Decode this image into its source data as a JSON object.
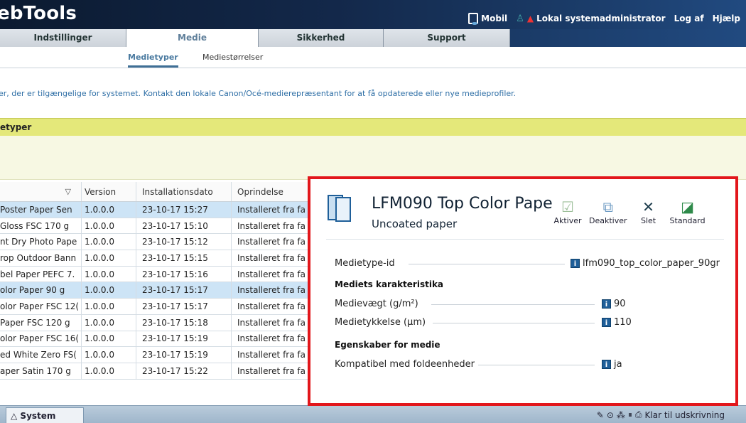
{
  "header": {
    "brand": "ebTools",
    "mobile_label": "Mobil",
    "user_label": "Lokal systemadministrator",
    "logout_label": "Log af",
    "help_label": "Hjælp"
  },
  "tabs": [
    {
      "label": "Indstillinger"
    },
    {
      "label": "Medie"
    },
    {
      "label": "Sikkerhed"
    },
    {
      "label": "Support"
    }
  ],
  "subtabs": [
    {
      "label": "Medietyper"
    },
    {
      "label": "Mediestørrelser"
    }
  ],
  "info_text": "er, der er tilgængelige for systemet. Kontakt den lokale Canon/Océ-medierepræsentant for at få opdaterede eller nye medieprofiler.",
  "panel": {
    "title": "etyper"
  },
  "table": {
    "headers": {
      "version": "Version",
      "date": "Installationsdato",
      "origin": "Oprindelse",
      "sort_glyph": "▽"
    },
    "rows": [
      {
        "name": "Poster Paper Sen",
        "version": "1.0.0.0",
        "date": "23-10-17 15:27",
        "origin": "Installeret fra fa",
        "selected": true
      },
      {
        "name": "Gloss FSC 170 g",
        "version": "1.0.0.0",
        "date": "23-10-17 15:10",
        "origin": "Installeret fra fa",
        "selected": false
      },
      {
        "name": "nt Dry Photo Pape",
        "version": "1.0.0.0",
        "date": "23-10-17 15:12",
        "origin": "Installeret fra fa",
        "selected": false
      },
      {
        "name": "rop Outdoor Bann",
        "version": "1.0.0.0",
        "date": "23-10-17 15:15",
        "origin": "Installeret fra fa",
        "selected": false
      },
      {
        "name": "bel Paper PEFC 7.",
        "version": "1.0.0.0",
        "date": "23-10-17 15:16",
        "origin": "Installeret fra fa",
        "selected": false
      },
      {
        "name": "olor Paper 90 g",
        "version": "1.0.0.0",
        "date": "23-10-17 15:17",
        "origin": "Installeret fra fa",
        "selected": true
      },
      {
        "name": "olor Paper FSC 12(",
        "version": "1.0.0.0",
        "date": "23-10-17 15:17",
        "origin": "Installeret fra fa",
        "selected": false
      },
      {
        "name": "Paper FSC 120 g",
        "version": "1.0.0.0",
        "date": "23-10-17 15:18",
        "origin": "Installeret fra fa",
        "selected": false
      },
      {
        "name": "olor Paper FSC 16(",
        "version": "1.0.0.0",
        "date": "23-10-17 15:19",
        "origin": "Installeret fra fa",
        "selected": false
      },
      {
        "name": "ed White Zero FS(",
        "version": "1.0.0.0",
        "date": "23-10-17 15:19",
        "origin": "Installeret fra fa",
        "selected": false
      },
      {
        "name": "aper Satin 170 g",
        "version": "1.0.0.0",
        "date": "23-10-17 15:22",
        "origin": "Installeret fra fa",
        "selected": false
      }
    ]
  },
  "popup": {
    "title": "LFM090 Top Color Pape",
    "subtitle": "Uncoated paper",
    "actions": {
      "activate": "Aktiver",
      "deactivate": "Deaktiver",
      "delete": "Slet",
      "default": "Standard"
    },
    "media_id_label": "Medietype-id",
    "media_id_value": "lfm090_top_color_paper_90gr",
    "section_characteristics": "Mediets karakteristika",
    "weight_label": "Medievægt (g/m²)",
    "weight_value": "90",
    "thickness_label": "Medietykkelse (µm)",
    "thickness_value": "110",
    "section_properties": "Egenskaber for medie",
    "folder_label": "Kompatibel med foldeenheder",
    "folder_value": "ja"
  },
  "statusbar": {
    "system_tab": "System",
    "status_text": "Klar til udskrivning"
  },
  "colors": {
    "highlight_border": "#e2161b",
    "selected_row": "#cde4f6",
    "panel_header": "#e4e87a"
  }
}
